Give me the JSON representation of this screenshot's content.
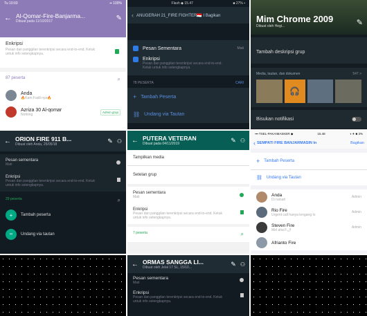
{
  "p1": {
    "status_time": "Tu 10:03",
    "status_right": "▪▪ 100%",
    "title": "Al-Qomar-Fire-Banjarma...",
    "subtitle": "Dibuat pada 11/10/2017",
    "encryption_title": "Enkripsi",
    "encryption_desc": "Pesan dan panggilan terenkripsi secara end-to-end. Ketuk untuk info selengkapnya.",
    "participants_label": "87 peserta",
    "members": [
      {
        "name": "Anda",
        "status": "🔥Kam Fadli nya🔥",
        "badge": ""
      },
      {
        "name": "Azriza 30 Al-qomar",
        "status": "Nothing",
        "badge": "Admin grup"
      }
    ]
  },
  "p2": {
    "status_time": "",
    "status_center": "Flash ◆ 15.47",
    "status_right": "■ 27% ▪",
    "title": "ANUGERAH 21_FIRE FIGHTER🇮🇩 I Bagikan",
    "items": [
      {
        "title": "Pesan Sementara",
        "desc": "",
        "value": "Mati"
      },
      {
        "title": "Enkripsi",
        "desc": "Pesan dan panggilan terenkripsi secara end-to-end. Ketuk untuk info selengkapnya.",
        "value": ""
      }
    ],
    "participants_label": "78 PESERTA",
    "search_label": "CARI",
    "add_label": "Tambah Peserta",
    "invite_label": "Undang via Tautan"
  },
  "p3": {
    "title": "Mim Chrome 2009",
    "subtitle": "Dibuat oleh Hegi...",
    "add_desc": "Tambah deskripsi grup",
    "media_label": "Media, tautan, dan dokumen",
    "media_count": "547 >",
    "mute_label": "Bisukan notifikasi"
  },
  "p4": {
    "title": "ORION FIRE 911 B...",
    "subtitle": "Dibuat oleh Anda, 25/05/18",
    "temp_title": "Pesan sementara",
    "temp_value": "Mati",
    "enc_title": "Enkripsi",
    "enc_desc": "Pesan dan panggilan terenkripsi secara end-to-end. Ketuk untuk info selengkapnya.",
    "participants_label": "29 peserta",
    "add_label": "Tambah peserta",
    "invite_label": "Undang via tautan"
  },
  "p5": {
    "title": "PUTERA VETERAN",
    "subtitle": "Dibuat pada 04/11/2019",
    "show_media": "Tampilkan media",
    "group_settings": "Setelan grup",
    "temp_title": "Pesan sementara",
    "temp_value": "Mati",
    "enc_title": "Enkripsi",
    "enc_desc": "Pesan dan panggilan terenkripsi secara end-to-end. Ketuk untuk info selengkapnya.",
    "participants_label": "7 peserta"
  },
  "p6": {
    "status_left": "▪▪▪ TSEL-PAKAIMASKER ◆",
    "status_time": "15.48",
    "status_right": "◑ ✈ ■ 3%",
    "title": "SEMPATI FIRE BANJARMASIN In",
    "share_label": "Bagikan",
    "add_label": "Tambah Peserta",
    "invite_label": "Undang via Tautan",
    "admin_label": "Admin",
    "members": [
      {
        "name": "Anda",
        "status": "Di rumah"
      },
      {
        "name": "Rio Fire",
        "status": "Urgent call hanya lengang lo"
      },
      {
        "name": "Steven Fire",
        "status": "Mel aha F🌶"
      },
      {
        "name": "Afrianto Fire",
        "status": ""
      }
    ]
  },
  "p7": {
    "title": "ORMAS SANGGA LI...",
    "subtitle": "Dibuat oleh Jelal 17 SL, 15/10...",
    "temp_title": "Pesan sementara",
    "temp_value": "Mati",
    "enc_title": "Enkripsi",
    "enc_desc": "Pesan dan panggilan terenkripsi secara end-to-end. Ketuk untuk info selengkapnya."
  },
  "colors": {
    "whatsapp_green": "#075e54",
    "purple_header": "#8d7bb7",
    "dark_bg": "#1b242a",
    "ios_blue": "#3478f6"
  }
}
